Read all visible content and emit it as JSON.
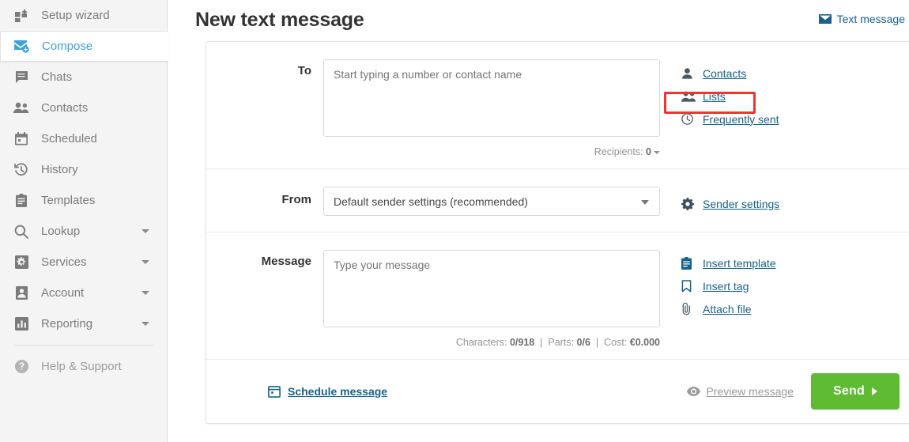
{
  "sidebar": {
    "items": [
      {
        "label": "Setup wizard",
        "icon": "grid-wizard-icon",
        "active": false,
        "caret": false
      },
      {
        "label": "Compose",
        "icon": "compose-envelope-icon",
        "active": true,
        "caret": false
      },
      {
        "label": "Chats",
        "icon": "chat-bubble-icon",
        "active": false,
        "caret": false
      },
      {
        "label": "Contacts",
        "icon": "contacts-people-icon",
        "active": false,
        "caret": false
      },
      {
        "label": "Scheduled",
        "icon": "calendar-icon",
        "active": false,
        "caret": false
      },
      {
        "label": "History",
        "icon": "clock-history-icon",
        "active": false,
        "caret": false
      },
      {
        "label": "Templates",
        "icon": "clipboard-icon",
        "active": false,
        "caret": false
      },
      {
        "label": "Lookup",
        "icon": "magnifier-icon",
        "active": false,
        "caret": true
      },
      {
        "label": "Services",
        "icon": "gear-square-icon",
        "active": false,
        "caret": true
      },
      {
        "label": "Account",
        "icon": "user-square-icon",
        "active": false,
        "caret": true
      },
      {
        "label": "Reporting",
        "icon": "bar-chart-icon",
        "active": false,
        "caret": true
      }
    ],
    "help": {
      "label": "Help & Support",
      "icon": "question-circle-icon"
    }
  },
  "header": {
    "title": "New text message",
    "message_type": {
      "label": "Text message",
      "icon": "envelope-icon",
      "caret": "chevron-down-icon"
    }
  },
  "form": {
    "to": {
      "label": "To",
      "placeholder": "Start typing a number or contact name",
      "value": "",
      "note_label": "Recipients:",
      "note_value": "0",
      "links": [
        {
          "label": "Contacts",
          "icon": "person-icon",
          "highlighted": false
        },
        {
          "label": "Lists",
          "icon": "people-icon",
          "highlighted": true
        },
        {
          "label": "Frequently sent",
          "icon": "clock-icon",
          "highlighted": false
        }
      ]
    },
    "from": {
      "label": "From",
      "selected": "Default sender settings (recommended)",
      "links": [
        {
          "label": "Sender settings",
          "icon": "gear-icon",
          "highlighted": false
        }
      ]
    },
    "message": {
      "label": "Message",
      "placeholder": "Type your message",
      "value": "",
      "counter": "Characters: 0/918  |  Parts: 0/6  |  Cost: €0.000",
      "characters_label": "Characters:",
      "characters_value": "0/918",
      "parts_label": "Parts:",
      "parts_value": "0/6",
      "cost_label": "Cost:",
      "cost_value": "€0.000",
      "links": [
        {
          "label": "Insert template",
          "icon": "clipboard-icon",
          "highlighted": false
        },
        {
          "label": "Insert tag",
          "icon": "bookmark-icon",
          "highlighted": false
        },
        {
          "label": "Attach file",
          "icon": "paperclip-icon",
          "highlighted": false
        }
      ]
    },
    "footer": {
      "schedule_label": "Schedule message",
      "schedule_icon": "calendar-icon",
      "preview_label": "Preview message",
      "preview_icon": "eye-icon",
      "send_label": "Send",
      "send_icon": "arrow-right-icon"
    }
  },
  "colors": {
    "accent_link": "#16628c",
    "active_nav": "#3ba3dd",
    "send_green": "#5fbb31",
    "highlight_red": "#f4322e",
    "sidebar_bg": "#f4f4f4"
  }
}
